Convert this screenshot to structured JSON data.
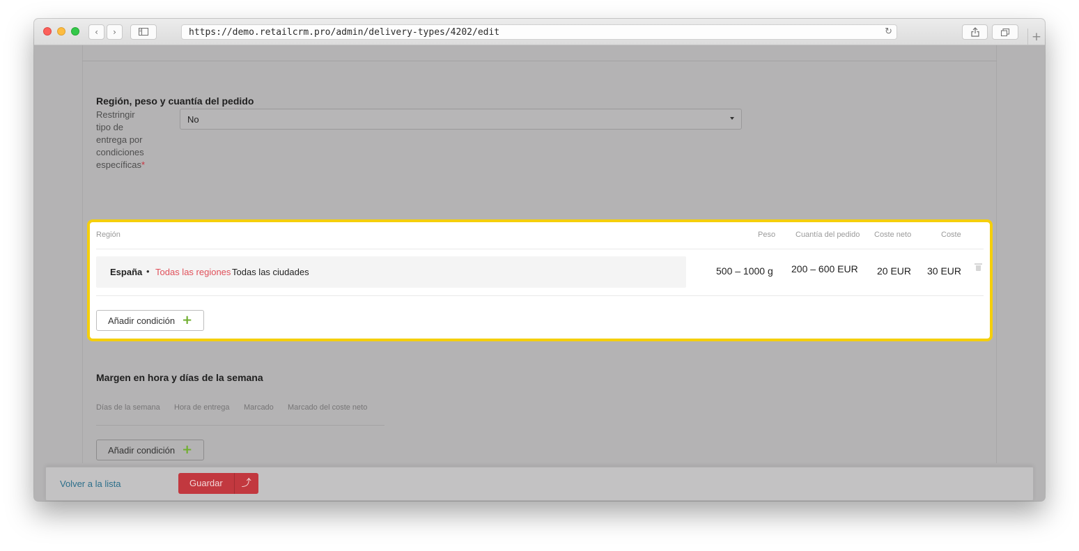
{
  "browser": {
    "url": "https://demo.retailcrm.pro/admin/delivery-types/4202/edit",
    "back_icon": "‹",
    "forward_icon": "›",
    "reload_icon": "↻",
    "new_tab_icon": "+"
  },
  "section_region": {
    "title": "Región, peso y cuantía del pedido",
    "restrict_label": "Restringir tipo de entrega por condiciones específicas",
    "required_mark": "*",
    "restrict_value": "No"
  },
  "conditions_table": {
    "headers": {
      "region": "Región",
      "weight": "Peso",
      "order_amount": "Cuantía del pedido",
      "net_cost": "Coste neto",
      "cost": "Coste"
    },
    "row": {
      "country": "España",
      "separator": "•",
      "regions": "Todas las regiones",
      "cities": "Todas las ciudades",
      "weight": "500  –  1000  g",
      "order_amount": "200  –  600  EUR",
      "net_cost": "20 EUR",
      "cost": "30 EUR"
    },
    "add_condition_label": "Añadir condición",
    "add_icon": "+",
    "highlight_color": "#f5cf0c"
  },
  "section_margin": {
    "title": "Margen en hora y días de la semana",
    "headers": {
      "weekdays": "Días de la semana",
      "delivery_time": "Hora de entrega",
      "markup": "Marcado",
      "net_markup": "Marcado del coste neto"
    },
    "add_condition_label": "Añadir condición",
    "add_icon": "+"
  },
  "footer": {
    "back_link": "Volver a la lista",
    "save_label": "Guardar",
    "save_up_icon": "⤴",
    "save_color": "#c2383f"
  }
}
